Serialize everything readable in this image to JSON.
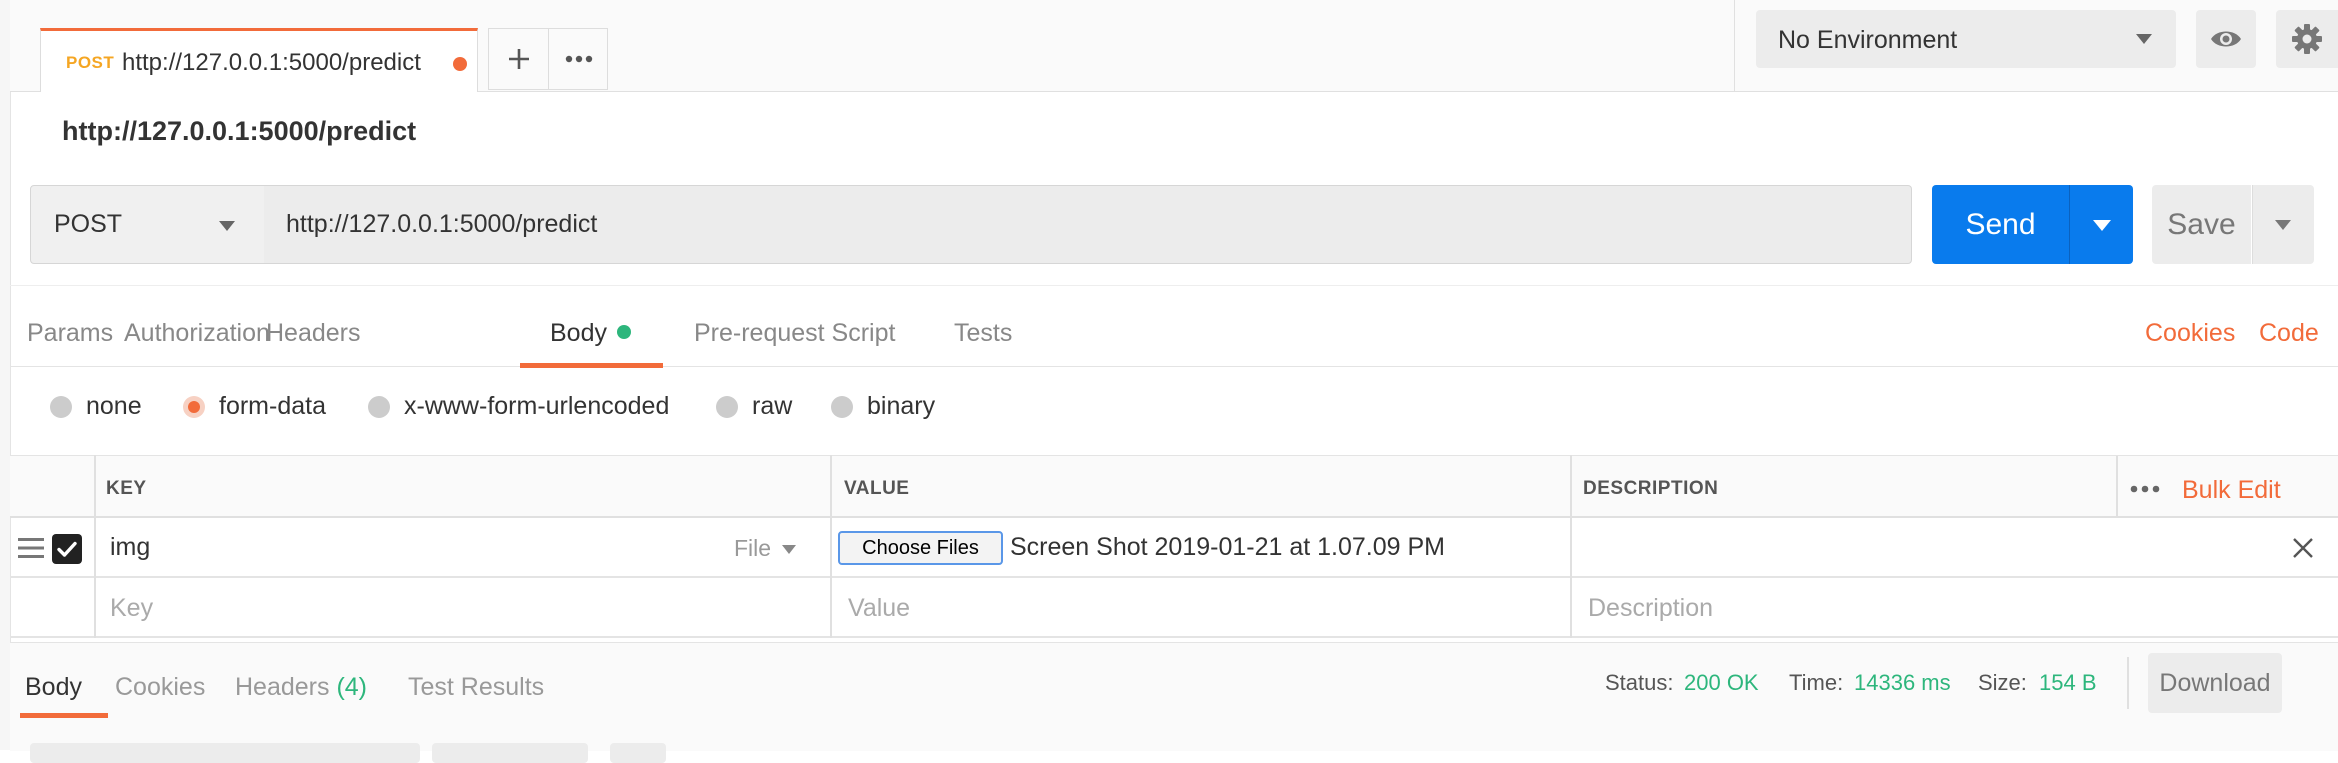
{
  "tab": {
    "method": "POST",
    "url": "http://127.0.0.1:5000/predict",
    "unsaved_indicator_color": "#f26b3a"
  },
  "tab_actions": {
    "new_tab_icon": "plus-icon",
    "more_icon": "ellipsis-icon"
  },
  "environment": {
    "selected": "No Environment",
    "quick_look_icon": "eye-icon",
    "settings_icon": "gear-icon"
  },
  "request": {
    "name": "http://127.0.0.1:5000/predict",
    "method": "POST",
    "url": "http://127.0.0.1:5000/predict",
    "send_label": "Send",
    "save_label": "Save"
  },
  "request_tabs": {
    "params": "Params",
    "authorization": "Authorization",
    "headers": "Headers",
    "body": "Body",
    "pre_request": "Pre-request Script",
    "tests": "Tests",
    "cookies_link": "Cookies",
    "code_link": "Code",
    "active": "Body",
    "body_indicator_color": "#2db67c"
  },
  "body_types": {
    "none": "none",
    "form_data": "form-data",
    "urlencoded": "x-www-form-urlencoded",
    "raw": "raw",
    "binary": "binary",
    "selected": "form-data"
  },
  "form_table": {
    "headers": {
      "key": "KEY",
      "value": "VALUE",
      "description": "DESCRIPTION",
      "bulk_edit": "Bulk Edit"
    },
    "rows": [
      {
        "checked": true,
        "key": "img",
        "type": "File",
        "choose_label": "Choose Files",
        "file_name": "Screen Shot 2019-01-21 at 1.07.09 PM",
        "description": ""
      }
    ],
    "placeholders": {
      "key": "Key",
      "value": "Value",
      "description": "Description"
    }
  },
  "response": {
    "tabs": {
      "body": "Body",
      "cookies": "Cookies",
      "headers": "Headers",
      "headers_count": "(4)",
      "test_results": "Test Results"
    },
    "active": "Body",
    "status_label": "Status:",
    "status_value": "200 OK",
    "time_label": "Time:",
    "time_value": "14336 ms",
    "size_label": "Size:",
    "size_value": "154 B",
    "download_label": "Download"
  },
  "colors": {
    "accent": "#f26b3a",
    "send": "#097bed",
    "success": "#2db67c",
    "method_tag": "#f5a623"
  }
}
